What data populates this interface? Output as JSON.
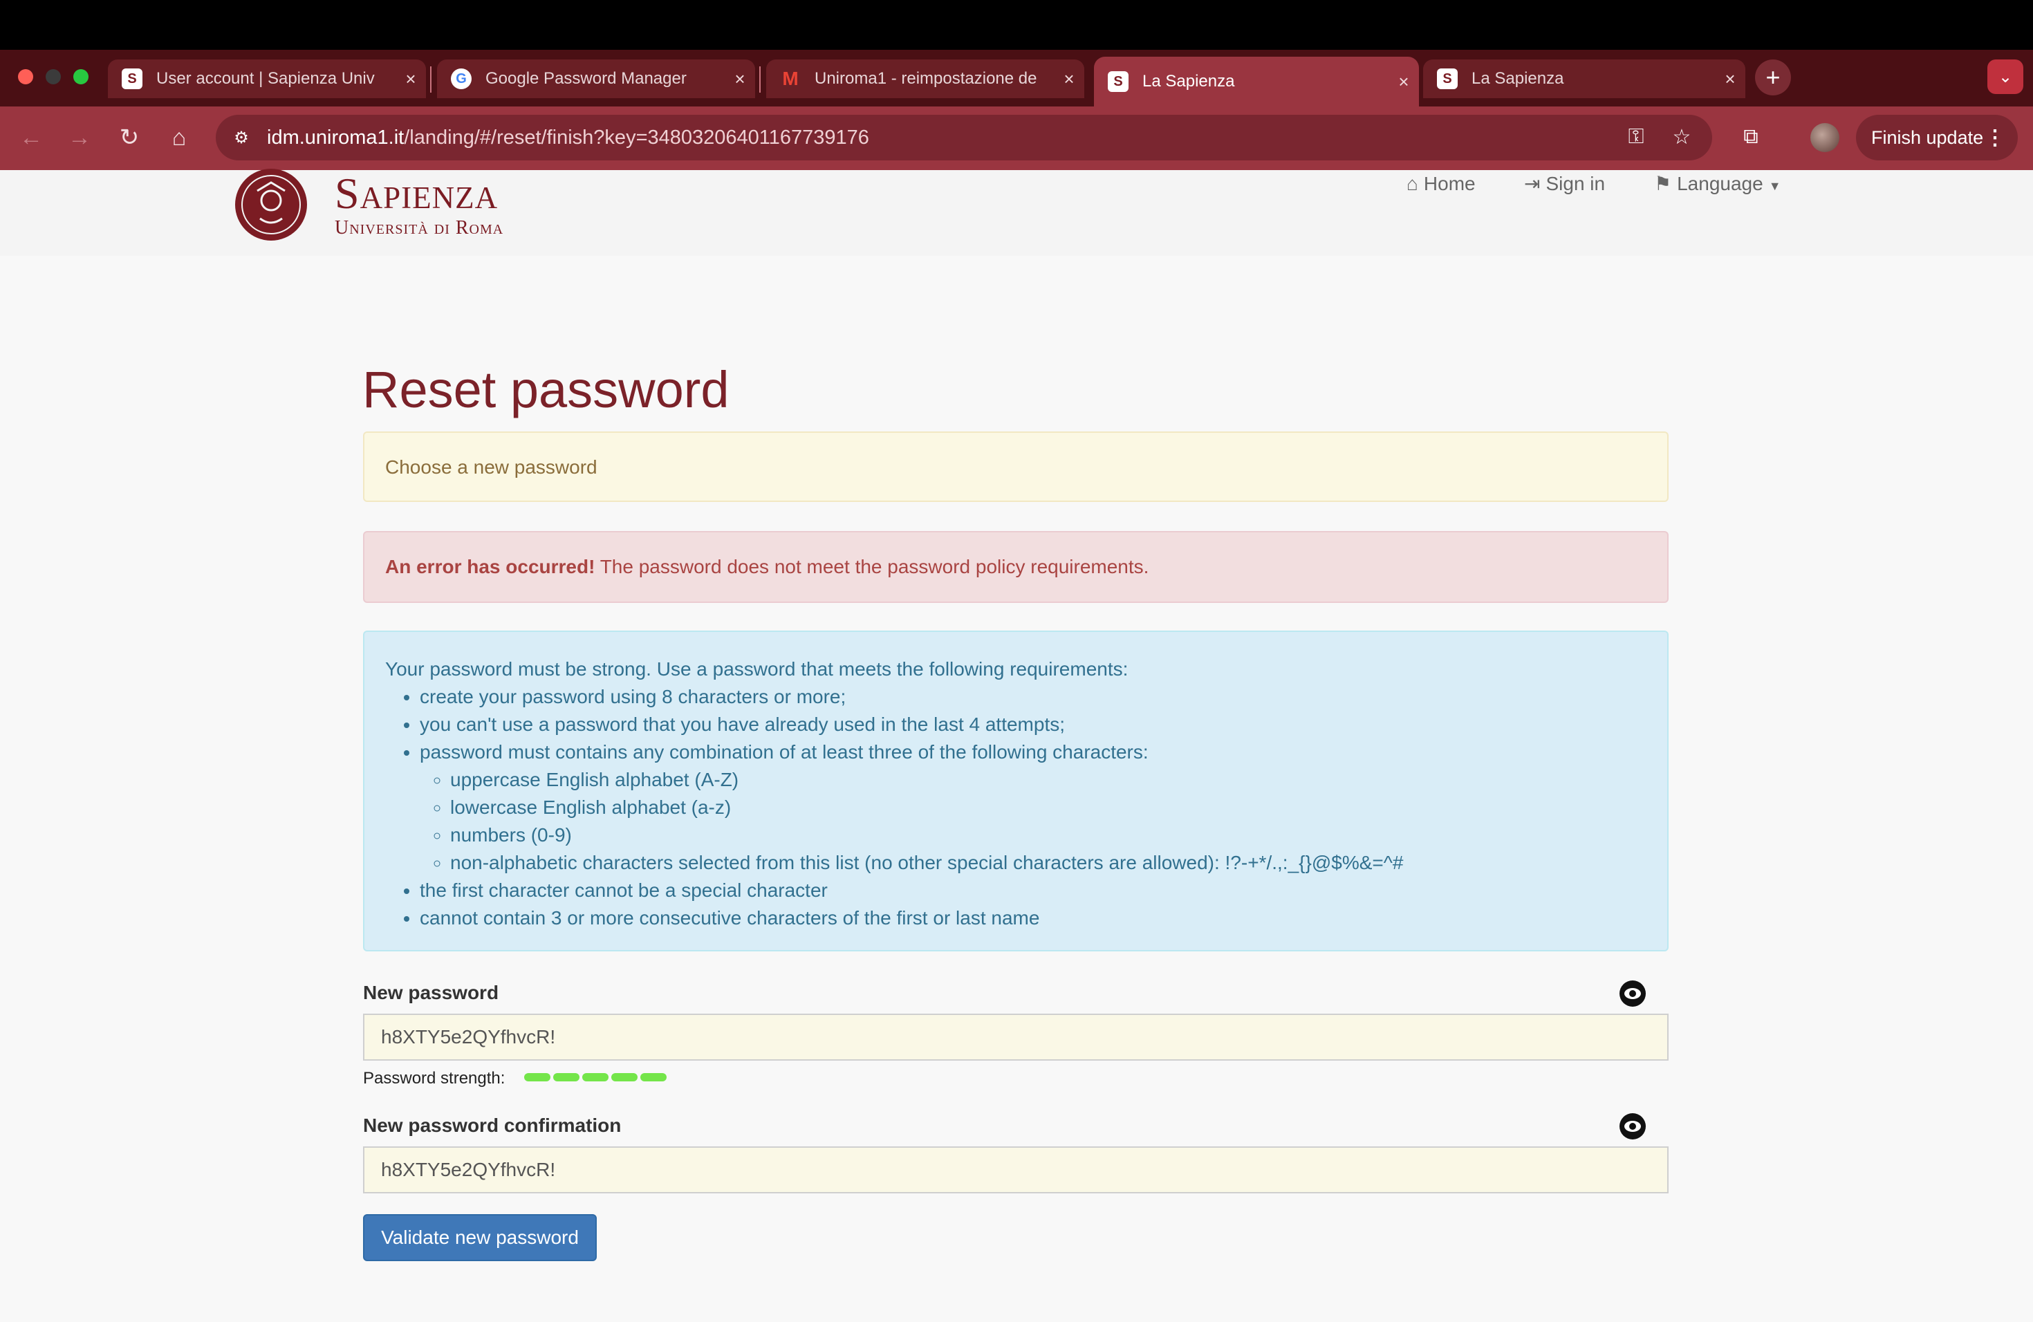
{
  "browser": {
    "tabs": [
      {
        "label": "User account | Sapienza Univ",
        "favicon": "S",
        "active": false
      },
      {
        "label": "Google Password Manager",
        "favicon": "G",
        "active": false
      },
      {
        "label": "Uniroma1 - reimpostazione de",
        "favicon": "M",
        "active": false
      },
      {
        "label": "La Sapienza",
        "favicon": "S",
        "active": true
      },
      {
        "label": "La Sapienza",
        "favicon": "S",
        "active": false
      }
    ],
    "url_host": "idm.uniroma1.it",
    "url_path": "/landing/#/reset/finish?key=34803206401167739176",
    "finish_update_label": "Finish update",
    "colors": {
      "frame": "#4a0f14",
      "toolbar": "#9a3540"
    }
  },
  "site": {
    "logo_word": "Sapienza",
    "logo_sub": "Università di Roma",
    "nav": {
      "home": "Home",
      "signin": "Sign in",
      "language": "Language"
    }
  },
  "page": {
    "title": "Reset password",
    "choose_msg": "Choose a new password",
    "error_strong": "An error has occurred!",
    "error_msg": " The password does not meet the password policy requirements.",
    "policy": {
      "intro": "Your password must be strong. Use a password that meets the following requirements:",
      "rules": [
        "create your password using 8 characters or more;",
        "you can't use a password that you have already used in the last 4 attempts;",
        "password must contains any combination of at least three of the following characters:"
      ],
      "subrules": [
        "uppercase English alphabet (A-Z)",
        "lowercase English alphabet (a-z)",
        "numbers (0-9)",
        "non-alphabetic characters selected from this list (no other special characters are allowed): !?-+*/.,:_{}@$%&=^#"
      ],
      "rules_after": [
        "the first character cannot be a special character",
        "cannot contain 3 or more consecutive characters of the first or last name"
      ]
    },
    "new_password_label": "New password",
    "new_password_value": "h8XTY5e2QYfhvcR!",
    "strength_label": "Password strength:",
    "strength_level": 1.0,
    "confirm_label": "New password confirmation",
    "confirm_value": "h8XTY5e2QYfhvcR!",
    "submit_label": "Validate new password",
    "colors": {
      "title": "#7b2229",
      "button": "#3f78b8",
      "strength": "#74e54a"
    }
  }
}
